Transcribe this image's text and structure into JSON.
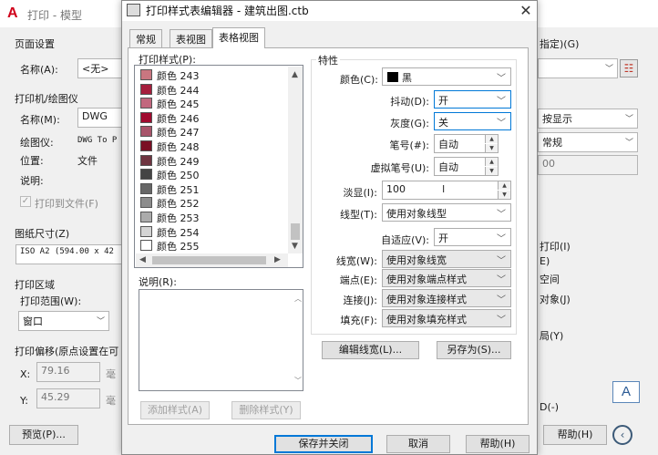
{
  "background": {
    "title": "打印 - 模型",
    "page_setup": {
      "group": "页面设置",
      "name_label": "名称(A):",
      "name_value": "<无>"
    },
    "printer": {
      "group": "打印机/绘图仪",
      "name_label": "名称(M):",
      "name_value": "DWG",
      "plotter_label": "绘图仪:",
      "plotter_value": "DWG To P",
      "location_label": "位置:",
      "location_value": "文件",
      "desc_label": "说明:",
      "plot_to_file": "打印到文件(F)"
    },
    "paper_size": {
      "group": "图纸尺寸(Z)",
      "value": "ISO A2 (594.00 x 42"
    },
    "plot_area": {
      "group": "打印区域",
      "range_label": "打印范围(W):",
      "range_value": "窗口"
    },
    "plot_offset": {
      "group": "打印偏移(原点设置在可",
      "x_label": "X:",
      "x_value": "79.16",
      "x_unit": "毫",
      "y_label": "Y:",
      "y_value": "45.29",
      "y_unit": "毫"
    },
    "preview_button": "预览(P)...",
    "right": {
      "assign_label": "指定)(G)",
      "shade_display": "按显示",
      "quality": "常规",
      "dpi": "00",
      "items": [
        "打印(I)",
        "E)",
        "空间",
        "对象(J)",
        "局(Y)"
      ],
      "orient_letter": "A",
      "partial_label": "D(-)",
      "help_button": "帮助(H)"
    }
  },
  "dialog": {
    "title": "打印样式表编辑器 - 建筑出图.ctb",
    "tabs": [
      {
        "label": "常规"
      },
      {
        "label": "表视图"
      },
      {
        "label": "表格视图"
      }
    ],
    "list_label": "打印样式(P):",
    "styles": [
      {
        "name": "颜色 243",
        "color": "#c97680"
      },
      {
        "name": "颜色 244",
        "color": "#a51e3c"
      },
      {
        "name": "颜色 245",
        "color": "#c2687e"
      },
      {
        "name": "颜色 246",
        "color": "#a00b2f"
      },
      {
        "name": "颜色 247",
        "color": "#a8546a"
      },
      {
        "name": "颜色 248",
        "color": "#7a0f24"
      },
      {
        "name": "颜色 249",
        "color": "#6e3440"
      },
      {
        "name": "颜色 250",
        "color": "#454545"
      },
      {
        "name": "颜色 251",
        "color": "#676767"
      },
      {
        "name": "颜色 252",
        "color": "#8c8c8c"
      },
      {
        "name": "颜色 253",
        "color": "#ababab"
      },
      {
        "name": "颜色 254",
        "color": "#d4d4d4"
      },
      {
        "name": "颜色 255",
        "color": "#ffffff"
      }
    ],
    "desc_label": "说明(R):",
    "add_style_button": "添加样式(A)",
    "delete_style_button": "删除样式(Y)",
    "properties": {
      "group": "特性",
      "color": {
        "label": "颜色(C):",
        "value": "黑",
        "swatch": "#000000"
      },
      "dither": {
        "label": "抖动(D):",
        "value": "开"
      },
      "grayscale": {
        "label": "灰度(G):",
        "value": "关"
      },
      "pen": {
        "label": "笔号(#):",
        "value": "自动"
      },
      "virtual_pen": {
        "label": "虚拟笔号(U):",
        "value": "自动"
      },
      "screening": {
        "label": "淡显(I):",
        "value": "100"
      },
      "linetype": {
        "label": "线型(T):",
        "value": "使用对象线型"
      },
      "adaptive": {
        "label": "自适应(V):",
        "value": "开"
      },
      "lineweight": {
        "label": "线宽(W):",
        "value": "使用对象线宽"
      },
      "endstyle": {
        "label": "端点(E):",
        "value": "使用对象端点样式"
      },
      "joinstyle": {
        "label": "连接(J):",
        "value": "使用对象连接样式"
      },
      "fillstyle": {
        "label": "填充(F):",
        "value": "使用对象填充样式"
      }
    },
    "edit_lineweights_button": "编辑线宽(L)...",
    "save_as_button": "另存为(S)...",
    "save_close_button": "保存并关闭",
    "cancel_button": "取消",
    "help_button": "帮助(H)"
  }
}
